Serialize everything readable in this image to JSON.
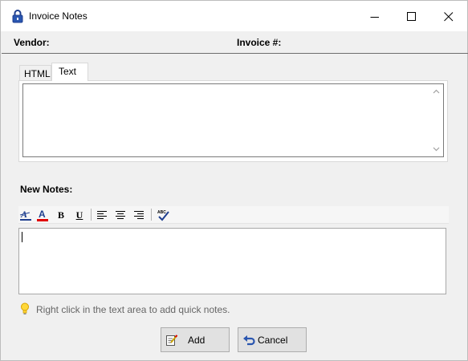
{
  "window": {
    "title": "Invoice Notes",
    "controls": {
      "minimize": "minimize-icon",
      "maximize": "maximize-icon",
      "close": "close-icon"
    }
  },
  "header": {
    "vendor_label": "Vendor:",
    "vendor_value": "",
    "invoice_label": "Invoice #:",
    "invoice_value": ""
  },
  "notes_view": {
    "tabs": [
      {
        "label": "HTML",
        "selected": false
      },
      {
        "label": "Text",
        "selected": true
      }
    ],
    "content": ""
  },
  "new_notes": {
    "label": "New Notes:",
    "toolbar": {
      "highlight": "highlight-color-icon",
      "font_color": "font-color-icon",
      "bold_label": "B",
      "underline_label": "U",
      "align_left": "align-left-icon",
      "align_center": "align-center-icon",
      "align_right": "align-right-icon",
      "spell_check": "spell-check-icon"
    },
    "editor_value": ""
  },
  "hint": {
    "icon": "lightbulb-icon",
    "text": "Right click in the text area to add quick notes."
  },
  "buttons": {
    "add_label": "Add",
    "cancel_label": "Cancel"
  },
  "colors": {
    "accent_red": "#e00000",
    "accent_blue": "#1f3f8f",
    "window_bg": "#f0f0f0"
  }
}
